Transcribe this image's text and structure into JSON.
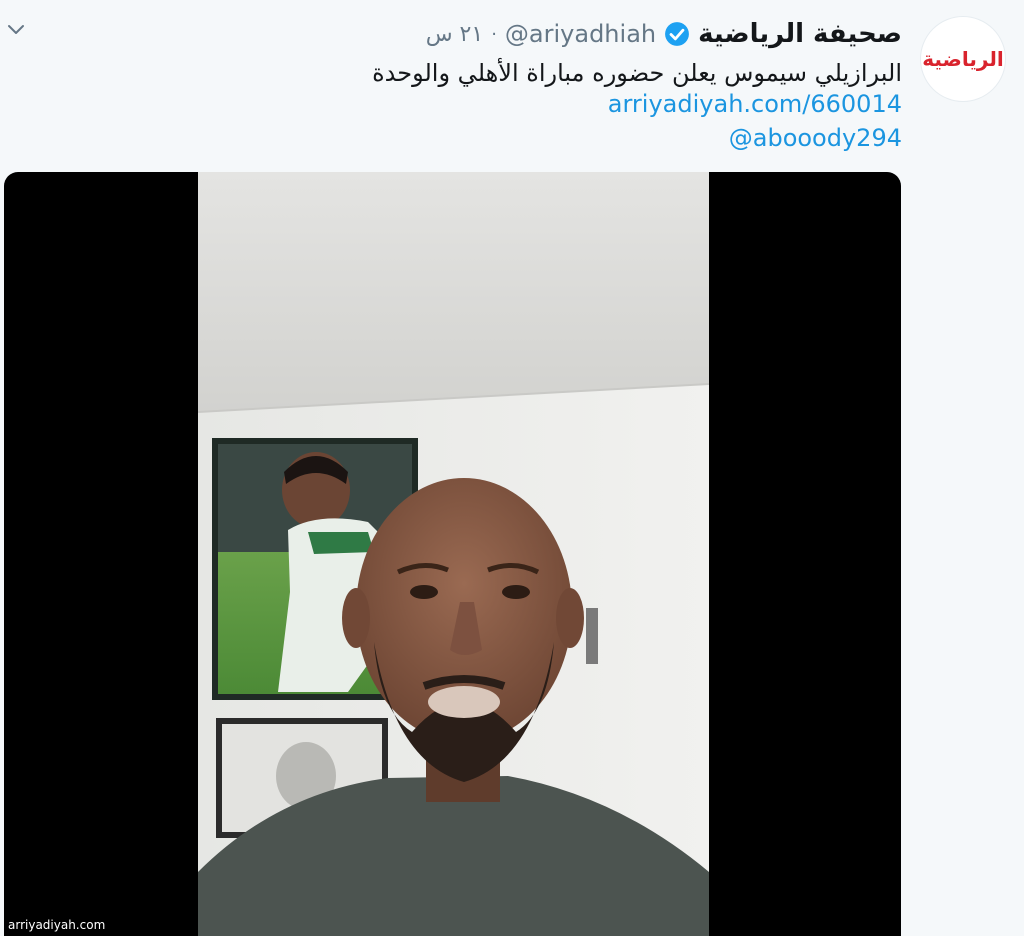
{
  "tweet": {
    "display_name": "صحيفة الرياضية",
    "handle": "@ariyadhiah",
    "separator": "·",
    "time": "٢١ س",
    "text": "البرازيلي سيموس يعلن حضوره مباراة الأهلي والوحدة",
    "link": "arriyadiyah.com/660014",
    "mention": "@abooody294",
    "avatar_text": "الرياضية",
    "verified": true
  },
  "media": {
    "type": "video",
    "watermark": "arriyadiyah.com"
  },
  "icons": {
    "caret": "chevron-down-icon",
    "verified": "verified-badge-icon"
  },
  "colors": {
    "background": "#f5f8fa",
    "link": "#1b95e0",
    "verified": "#1da1f2",
    "secondary_text": "#657786",
    "avatar_brand": "#d9232d"
  }
}
